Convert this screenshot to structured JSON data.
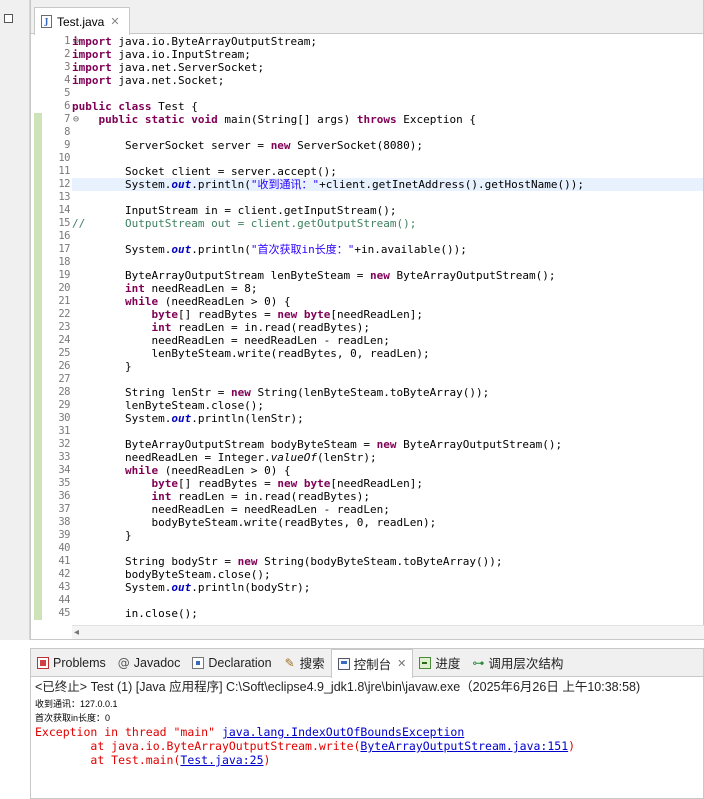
{
  "editor": {
    "tab": {
      "filename": "Test.java",
      "icon": "java-file-icon",
      "close": "✕"
    }
  },
  "code": {
    "line_numbers": [
      "1",
      "2",
      "3",
      "4",
      "5",
      "6",
      "7",
      "8",
      "9",
      "10",
      "11",
      "12",
      "13",
      "14",
      "15",
      "16",
      "17",
      "18",
      "19",
      "20",
      "21",
      "22",
      "23",
      "24",
      "25",
      "26",
      "27",
      "28",
      "29",
      "30",
      "31",
      "32",
      "33",
      "34",
      "35",
      "36",
      "37",
      "38",
      "39",
      "40",
      "41",
      "42",
      "43",
      "44",
      "45"
    ],
    "lines": [
      "import java.io.ByteArrayOutputStream;",
      "import java.io.InputStream;",
      "import java.net.ServerSocket;",
      "import java.net.Socket;",
      "",
      "public class Test {",
      "    public static void main(String[] args) throws Exception {",
      "",
      "        ServerSocket server = new ServerSocket(8080);",
      "",
      "        Socket client = server.accept();",
      "        System.out.println(\"收到通讯：\"+client.getInetAddress().getHostName());",
      "",
      "        InputStream in = client.getInputStream();",
      "//      OutputStream out = client.getOutputStream();",
      "",
      "        System.out.println(\"首次获取in长度：\"+in.available());",
      "",
      "        ByteArrayOutputStream lenByteSteam = new ByteArrayOutputStream();",
      "        int needReadLen = 8;",
      "        while (needReadLen > 0) {",
      "            byte[] readBytes = new byte[needReadLen];",
      "            int readLen = in.read(readBytes);",
      "            needReadLen = needReadLen - readLen;",
      "            lenByteSteam.write(readBytes, 0, readLen);",
      "        }",
      "",
      "        String lenStr = new String(lenByteSteam.toByteArray());",
      "        lenByteSteam.close();",
      "        System.out.println(lenStr);",
      "",
      "        ByteArrayOutputStream bodyByteSteam = new ByteArrayOutputStream();",
      "        needReadLen = Integer.valueOf(lenStr);",
      "        while (needReadLen > 0) {",
      "            byte[] readBytes = new byte[needReadLen];",
      "            int readLen = in.read(readBytes);",
      "            needReadLen = needReadLen - readLen;",
      "            bodyByteSteam.write(readBytes, 0, readLen);",
      "        }",
      "",
      "        String bodyStr = new String(bodyByteSteam.toByteArray());",
      "        bodyByteSteam.close();",
      "        System.out.println(bodyStr);",
      "",
      "        in.close();"
    ]
  },
  "panel": {
    "tabs": [
      {
        "label": "Problems",
        "icon": "problems-icon"
      },
      {
        "label": "Javadoc",
        "icon": "javadoc-icon"
      },
      {
        "label": "Declaration",
        "icon": "declaration-icon"
      },
      {
        "label": "搜索",
        "icon": "search-icon"
      },
      {
        "label": "控制台",
        "icon": "console-icon",
        "close": "✕"
      },
      {
        "label": "进度",
        "icon": "progress-icon"
      },
      {
        "label": "调用层次结构",
        "icon": "call-hierarchy-icon"
      }
    ],
    "console": {
      "header": "<已终止> Test (1)  [Java 应用程序] C:\\Soft\\eclipse4.9_jdk1.8\\jre\\bin\\javaw.exe（2025年6月26日 上午10:38:58)",
      "out1": "收到通讯：127.0.0.1",
      "out2": "首次获取in长度：0",
      "err1_prefix": "Exception in thread \"main\" ",
      "err1_link": "java.lang.IndexOutOfBoundsException",
      "err2_prefix": "\tat java.io.ByteArrayOutputStream.write(",
      "err2_link": "ByteArrayOutputStream.java:151",
      "err2_suffix": ")",
      "err3_prefix": "\tat Test.main(",
      "err3_link": "Test.java:25",
      "err3_suffix": ")"
    }
  },
  "colors": {
    "keyword": "#7f0055",
    "string": "#2a00ff",
    "field": "#0000c0",
    "comment": "#3f7f5f",
    "error": "#e00000",
    "highlight": "#e8f2fe"
  }
}
